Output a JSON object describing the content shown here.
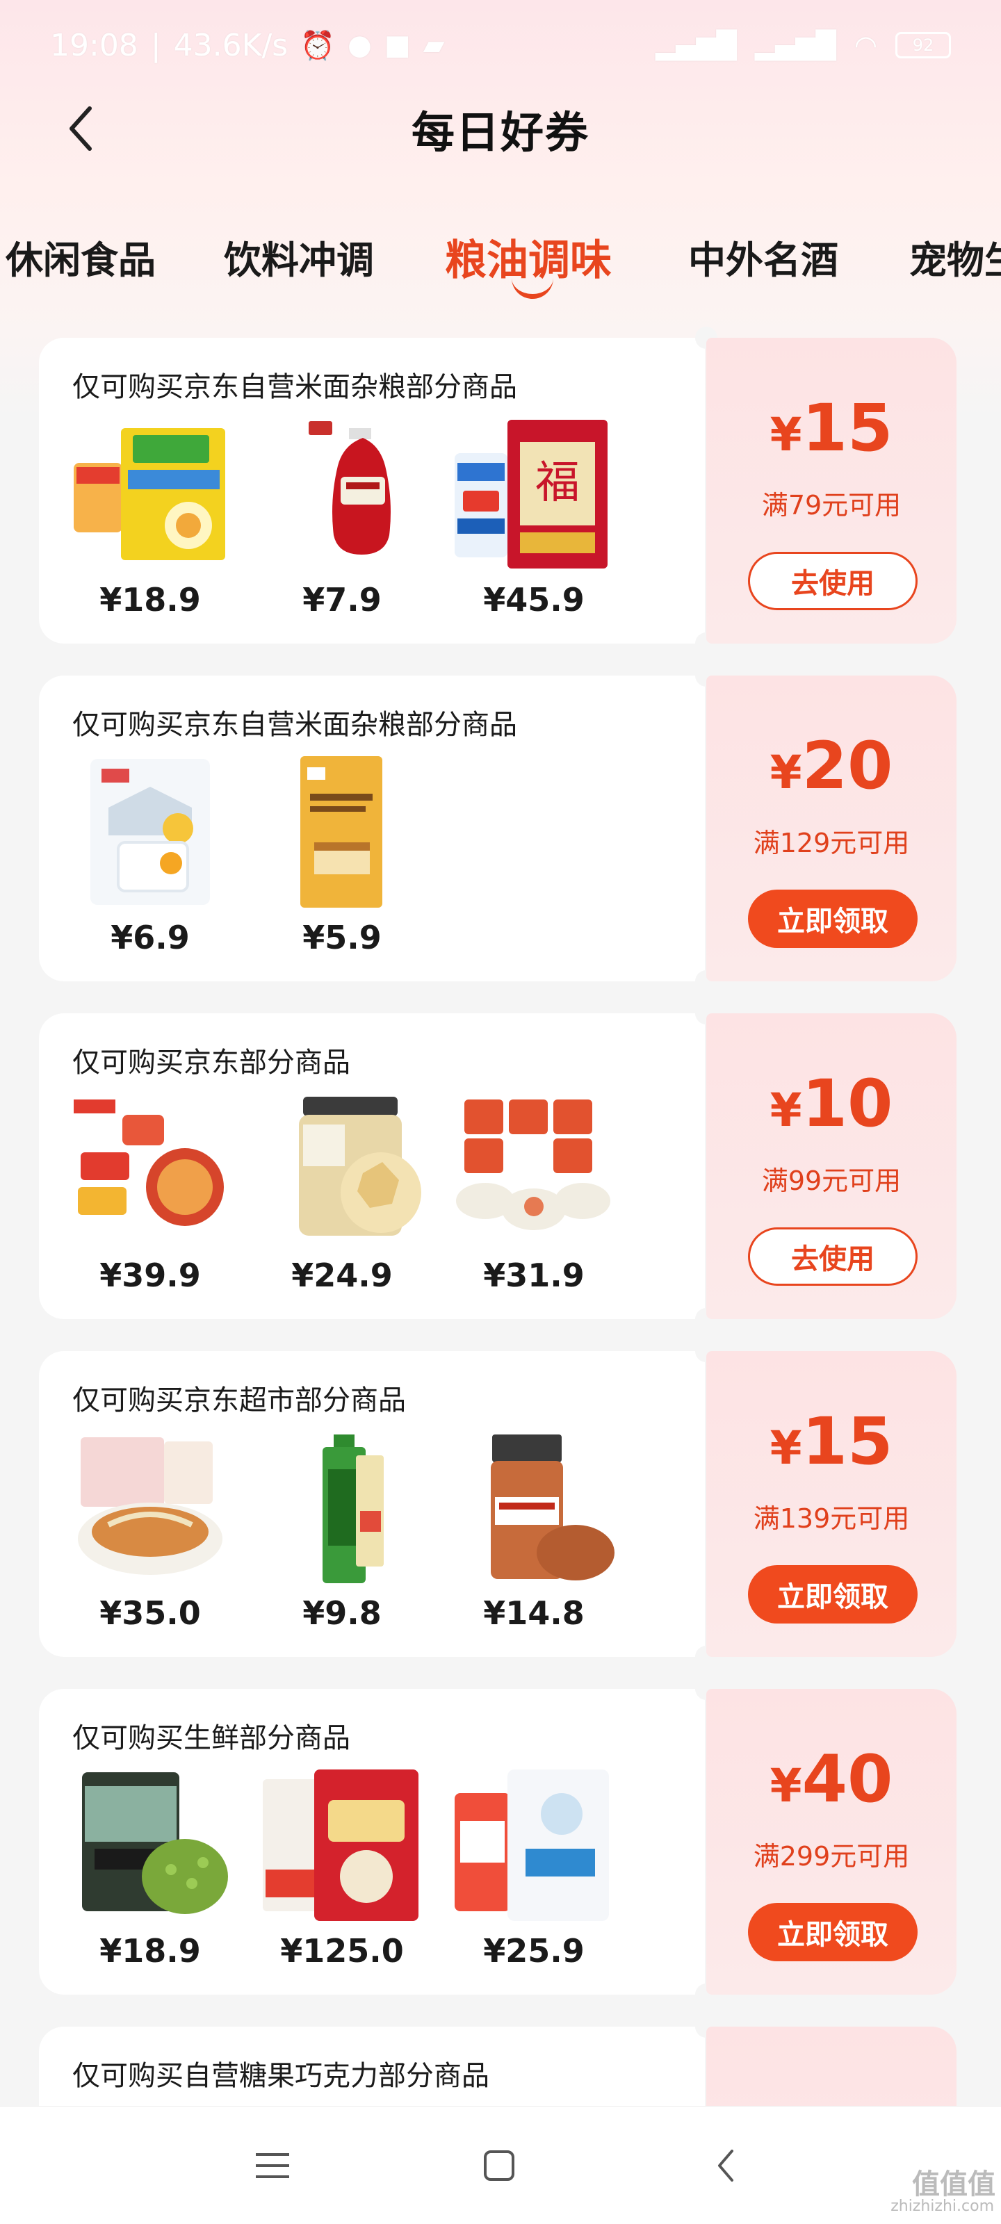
{
  "status": {
    "time": "19:08",
    "speed": "43.6K/s",
    "battery": "92"
  },
  "header": {
    "title": "每日好券"
  },
  "tabs": [
    {
      "label": "休闲食品",
      "active": false
    },
    {
      "label": "饮料冲调",
      "active": false
    },
    {
      "label": "粮油调味",
      "active": true
    },
    {
      "label": "中外名酒",
      "active": false
    },
    {
      "label": "宠物生",
      "active": false
    }
  ],
  "coupons": [
    {
      "title": "仅可购买京东自营米面杂粮部分商品",
      "products": [
        {
          "price": "¥18.9",
          "icon": "seasoning-pack-icon"
        },
        {
          "price": "¥7.9",
          "icon": "ketchup-bottle-icon"
        },
        {
          "price": "¥45.9",
          "icon": "rice-bag-icon"
        }
      ],
      "yen": "¥",
      "amount": "15",
      "condition": "满79元可用",
      "button": "去使用",
      "button_style": "outline"
    },
    {
      "title": "仅可购买京东自营米面杂粮部分商品",
      "products": [
        {
          "price": "¥6.9",
          "icon": "starch-pack-icon"
        },
        {
          "price": "¥5.9",
          "icon": "flour-pack-icon"
        }
      ],
      "yen": "¥",
      "amount": "20",
      "condition": "满129元可用",
      "button": "立即领取",
      "button_style": "filled"
    },
    {
      "title": "仅可购买京东部分商品",
      "products": [
        {
          "price": "¥39.9",
          "icon": "noodle-cups-icon"
        },
        {
          "price": "¥24.9",
          "icon": "rock-sugar-jar-icon"
        },
        {
          "price": "¥31.9",
          "icon": "instant-soup-icon"
        }
      ],
      "yen": "¥",
      "amount": "10",
      "condition": "满99元可用",
      "button": "去使用",
      "button_style": "outline"
    },
    {
      "title": "仅可购买京东超市部分商品",
      "products": [
        {
          "price": "¥35.0",
          "icon": "rice-noodle-bowl-icon"
        },
        {
          "price": "¥9.8",
          "icon": "wasabi-tube-icon"
        },
        {
          "price": "¥14.8",
          "icon": "bbq-spice-jar-icon"
        }
      ],
      "yen": "¥",
      "amount": "15",
      "condition": "满139元可用",
      "button": "立即领取",
      "button_style": "filled"
    },
    {
      "title": "仅可购买生鲜部分商品",
      "products": [
        {
          "price": "¥18.9",
          "icon": "mung-beans-icon"
        },
        {
          "price": "¥125.0",
          "icon": "red-rice-bag-icon"
        },
        {
          "price": "¥25.9",
          "icon": "white-flour-bag-icon"
        }
      ],
      "yen": "¥",
      "amount": "40",
      "condition": "满299元可用",
      "button": "立即领取",
      "button_style": "filled"
    },
    {
      "title": "仅可购买自营糖果巧克力部分商品",
      "products": [],
      "yen": "",
      "amount": "",
      "condition": "",
      "button": "",
      "button_style": "none"
    }
  ],
  "colors": {
    "accent": "#e8451e",
    "coupon_bg": "#fde3e4"
  },
  "watermark": {
    "main": "值值值",
    "sub": "zhizhizhi.com"
  }
}
